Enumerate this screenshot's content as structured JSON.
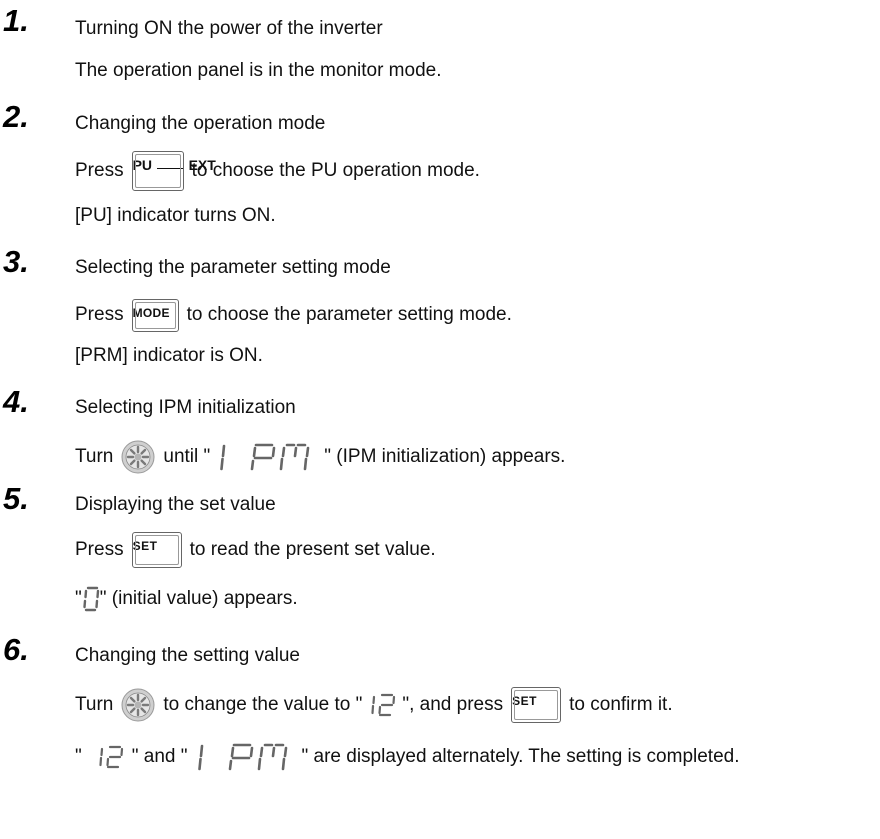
{
  "steps": [
    {
      "number": "1.",
      "title": "Turning ON the power of the inverter",
      "lines": [
        "The operation panel is in the monitor mode."
      ]
    },
    {
      "number": "2.",
      "title": "Changing the operation mode",
      "press": "Press",
      "press_after": "to choose the PU operation mode.",
      "line2": "[PU] indicator turns ON.",
      "key": {
        "top": "PU",
        "bottom": "EXT"
      }
    },
    {
      "number": "3.",
      "title": "Selecting the parameter setting mode",
      "press": "Press",
      "press_after": "to choose the parameter setting mode.",
      "line2": "[PRM] indicator is ON.",
      "key": "MODE"
    },
    {
      "number": "4.",
      "title": "Selecting IPM initialization",
      "turn": "Turn",
      "until": "until \"",
      "display": "IPM",
      "after": "\" (IPM initialization) appears."
    },
    {
      "number": "5.",
      "title": "Displaying the set value",
      "press": "Press",
      "press_after": "to read the present set value.",
      "key": "SET",
      "q_open": "\"",
      "display": "0",
      "after": "\" (initial value) appears."
    },
    {
      "number": "6.",
      "title": "Changing the setting value",
      "turn": "Turn",
      "mid1": "to change the value to \"",
      "display": "12",
      "mid2": "\", and press",
      "key": "SET",
      "end": "to confirm it.",
      "l2_open": "\"",
      "l2_mid": "\" and \"",
      "display2": "IPM",
      "l2_end": "\" are displayed alternately. The setting is completed."
    }
  ]
}
